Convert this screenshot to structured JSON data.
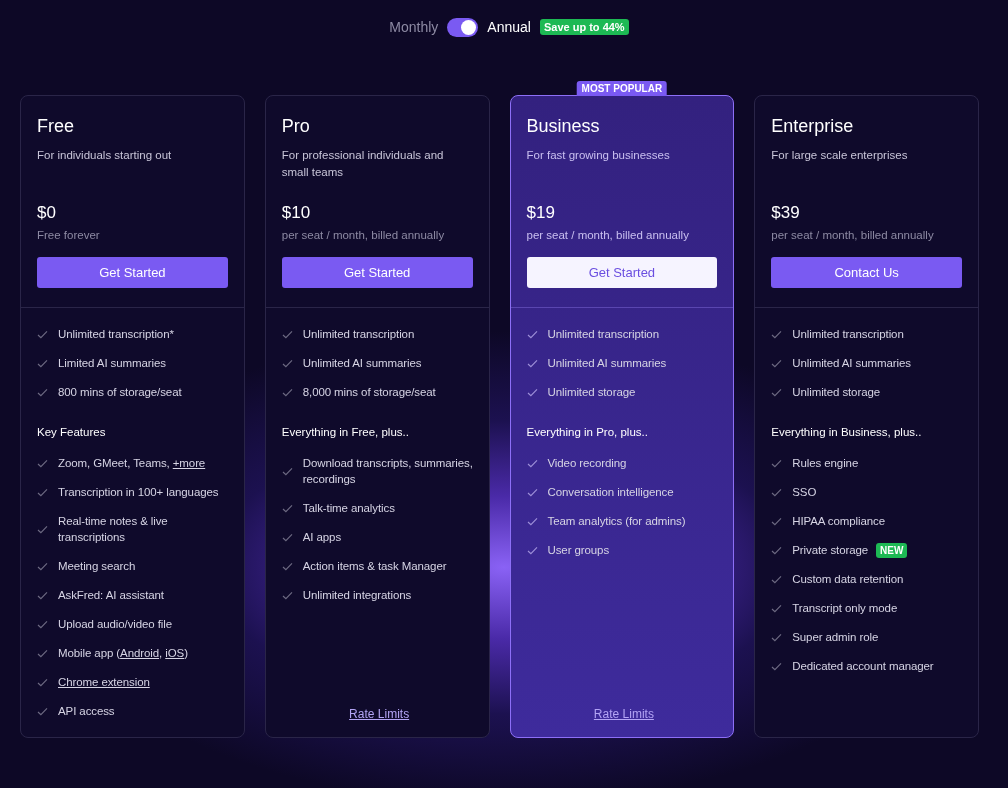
{
  "billing_toggle": {
    "left_label": "Monthly",
    "right_label": "Annual",
    "annual_on": true,
    "badge": "Save up to 44%"
  },
  "plans": [
    {
      "name": "Free",
      "subtitle": "For individuals starting out",
      "price": "$0",
      "price_note": "Free forever",
      "highlighted": false,
      "button": {
        "label": "Get Started",
        "kind": "primary"
      },
      "base_features": [
        {
          "parts": [
            {
              "text": "Unlimited transcription*"
            }
          ]
        },
        {
          "parts": [
            {
              "text": "Limited AI summaries"
            }
          ]
        },
        {
          "parts": [
            {
              "text": "800 mins of storage/seat"
            }
          ]
        }
      ],
      "section_title": "Key Features",
      "features": [
        {
          "parts": [
            {
              "text": "Zoom, GMeet, Teams, "
            },
            {
              "text": "+more",
              "link": true
            }
          ]
        },
        {
          "parts": [
            {
              "text": "Transcription in 100+ languages"
            }
          ]
        },
        {
          "parts": [
            {
              "text": "Real-time notes & live transcriptions"
            }
          ]
        },
        {
          "parts": [
            {
              "text": "Meeting search"
            }
          ]
        },
        {
          "parts": [
            {
              "text": "AskFred: AI assistant"
            }
          ]
        },
        {
          "parts": [
            {
              "text": "Upload audio/video file"
            }
          ]
        },
        {
          "parts": [
            {
              "text": "Mobile app ("
            },
            {
              "text": "Android",
              "link": true
            },
            {
              "text": ", "
            },
            {
              "text": "iOS",
              "link": true
            },
            {
              "text": ")"
            }
          ]
        },
        {
          "parts": [
            {
              "text": "Chrome extension",
              "link": true
            }
          ]
        },
        {
          "parts": [
            {
              "text": "API access"
            }
          ]
        }
      ]
    },
    {
      "name": "Pro",
      "subtitle": "For professional individuals and small teams",
      "price": "$10",
      "price_note": "per seat / month, billed annually",
      "highlighted": false,
      "button": {
        "label": "Get Started",
        "kind": "primary"
      },
      "base_features": [
        {
          "parts": [
            {
              "text": "Unlimited transcription"
            }
          ]
        },
        {
          "parts": [
            {
              "text": "Unlimited AI summaries"
            }
          ]
        },
        {
          "parts": [
            {
              "text": "8,000 mins of storage/seat"
            }
          ]
        }
      ],
      "section_title": "Everything in Free, plus..",
      "features": [
        {
          "parts": [
            {
              "text": "Download transcripts, summaries, recordings"
            }
          ]
        },
        {
          "parts": [
            {
              "text": "Talk-time analytics"
            }
          ]
        },
        {
          "parts": [
            {
              "text": "AI apps"
            }
          ]
        },
        {
          "parts": [
            {
              "text": "Action items & task Manager"
            }
          ]
        },
        {
          "parts": [
            {
              "text": "Unlimited integrations"
            }
          ]
        }
      ],
      "footer_link": "Rate Limits"
    },
    {
      "name": "Business",
      "subtitle": "For fast growing businesses",
      "price": "$19",
      "price_note": "per seat / month, billed annually",
      "highlighted": true,
      "ribbon": "MOST POPULAR",
      "button": {
        "label": "Get Started",
        "kind": "light"
      },
      "base_features": [
        {
          "parts": [
            {
              "text": "Unlimited transcription"
            }
          ]
        },
        {
          "parts": [
            {
              "text": "Unlimited AI summaries"
            }
          ]
        },
        {
          "parts": [
            {
              "text": "Unlimited storage"
            }
          ]
        }
      ],
      "section_title": "Everything in Pro, plus..",
      "features": [
        {
          "parts": [
            {
              "text": "Video recording"
            }
          ]
        },
        {
          "parts": [
            {
              "text": "Conversation intelligence"
            }
          ]
        },
        {
          "parts": [
            {
              "text": "Team analytics (for admins)"
            }
          ]
        },
        {
          "parts": [
            {
              "text": "User groups"
            }
          ]
        }
      ],
      "footer_link": "Rate Limits"
    },
    {
      "name": "Enterprise",
      "subtitle": "For large scale enterprises",
      "price": "$39",
      "price_note": "per seat / month, billed annually",
      "highlighted": false,
      "button": {
        "label": "Contact Us",
        "kind": "primary"
      },
      "base_features": [
        {
          "parts": [
            {
              "text": "Unlimited transcription"
            }
          ]
        },
        {
          "parts": [
            {
              "text": "Unlimited AI summaries"
            }
          ]
        },
        {
          "parts": [
            {
              "text": "Unlimited storage"
            }
          ]
        }
      ],
      "section_title": "Everything in Business, plus..",
      "features": [
        {
          "parts": [
            {
              "text": "Rules engine"
            }
          ]
        },
        {
          "parts": [
            {
              "text": "SSO"
            }
          ]
        },
        {
          "parts": [
            {
              "text": "HIPAA compliance"
            }
          ]
        },
        {
          "parts": [
            {
              "text": "Private storage"
            }
          ],
          "badge": "NEW"
        },
        {
          "parts": [
            {
              "text": "Custom data retention"
            }
          ]
        },
        {
          "parts": [
            {
              "text": "Transcript only mode"
            }
          ]
        },
        {
          "parts": [
            {
              "text": "Super admin role"
            }
          ]
        },
        {
          "parts": [
            {
              "text": "Dedicated account manager"
            }
          ]
        }
      ]
    }
  ]
}
